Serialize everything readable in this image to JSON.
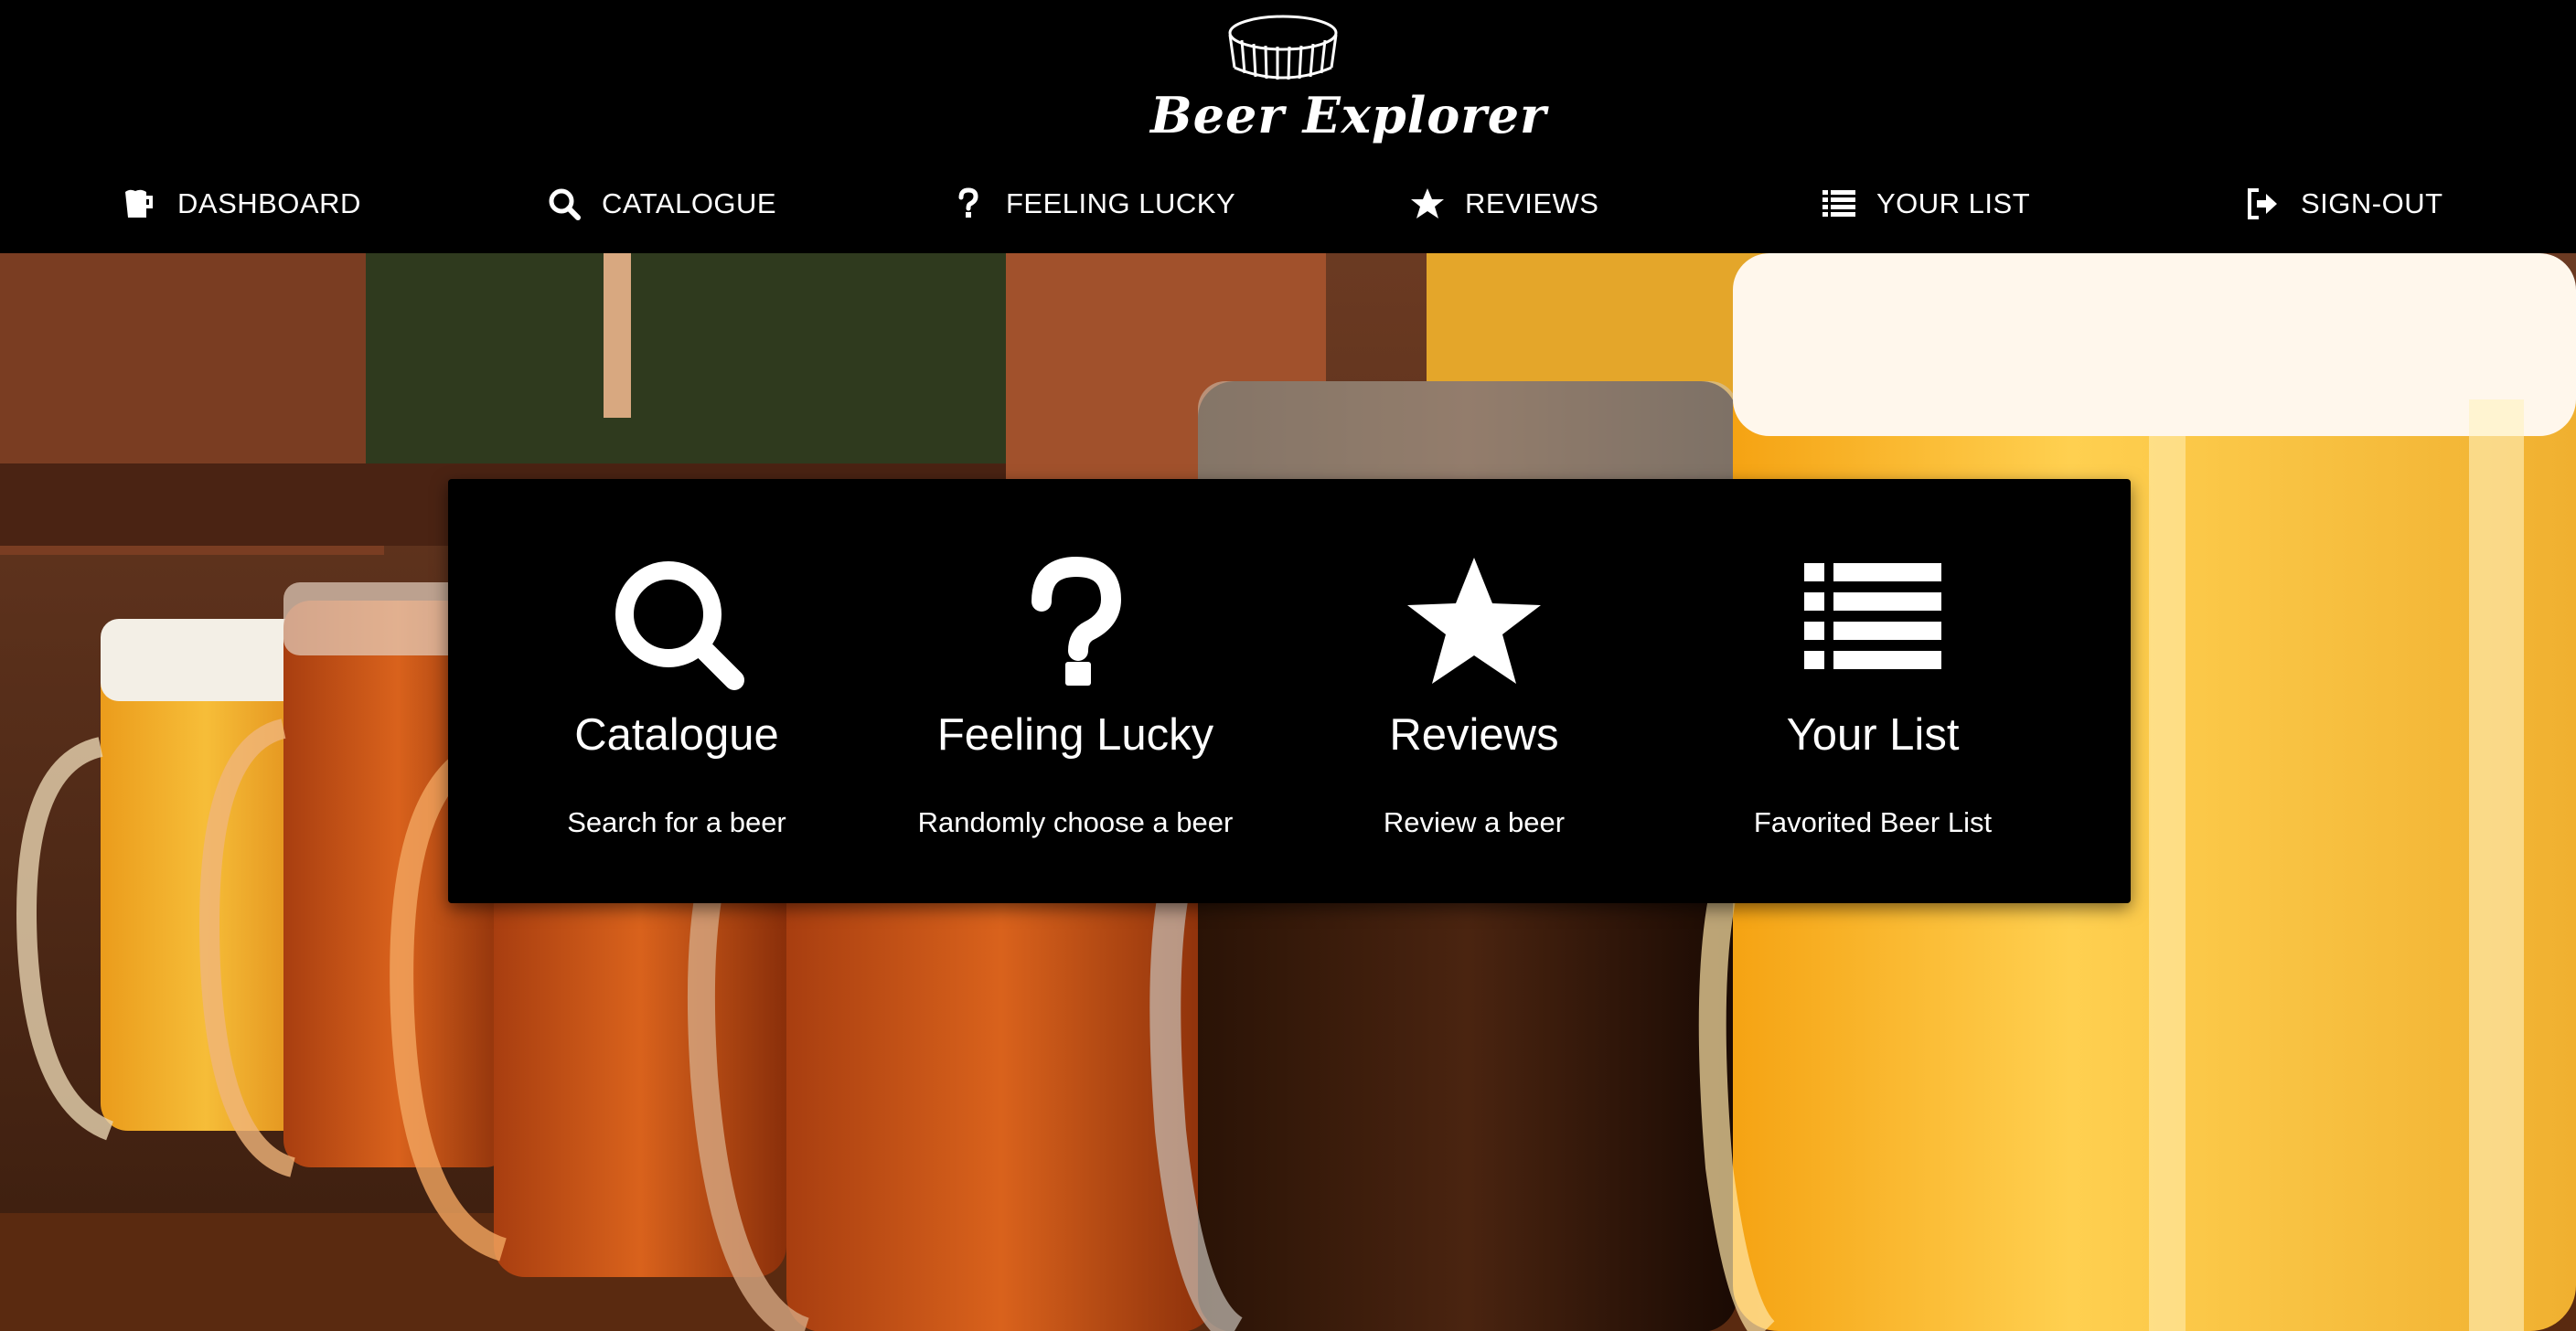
{
  "brand": {
    "name": "Beer Explorer",
    "logo_icon": "bottle-cap-icon"
  },
  "nav": {
    "items": [
      {
        "label": "DASHBOARD",
        "icon": "beer-mug-icon"
      },
      {
        "label": "CATALOGUE",
        "icon": "search-icon"
      },
      {
        "label": "FEELING LUCKY",
        "icon": "question-icon"
      },
      {
        "label": "REVIEWS",
        "icon": "star-icon"
      },
      {
        "label": "YOUR LIST",
        "icon": "list-icon"
      },
      {
        "label": "SIGN-OUT",
        "icon": "sign-out-icon"
      }
    ]
  },
  "features": [
    {
      "title": "Catalogue",
      "subtitle": "Search for a beer",
      "icon": "search-icon"
    },
    {
      "title": "Feeling Lucky",
      "subtitle": "Randomly choose a beer",
      "icon": "question-icon"
    },
    {
      "title": "Reviews",
      "subtitle": "Review a beer",
      "icon": "star-icon"
    },
    {
      "title": "Your List",
      "subtitle": "Favorited Beer List",
      "icon": "list-icon"
    }
  ],
  "colors": {
    "header_bg": "#000000",
    "panel_bg": "#000000",
    "text": "#ffffff"
  }
}
